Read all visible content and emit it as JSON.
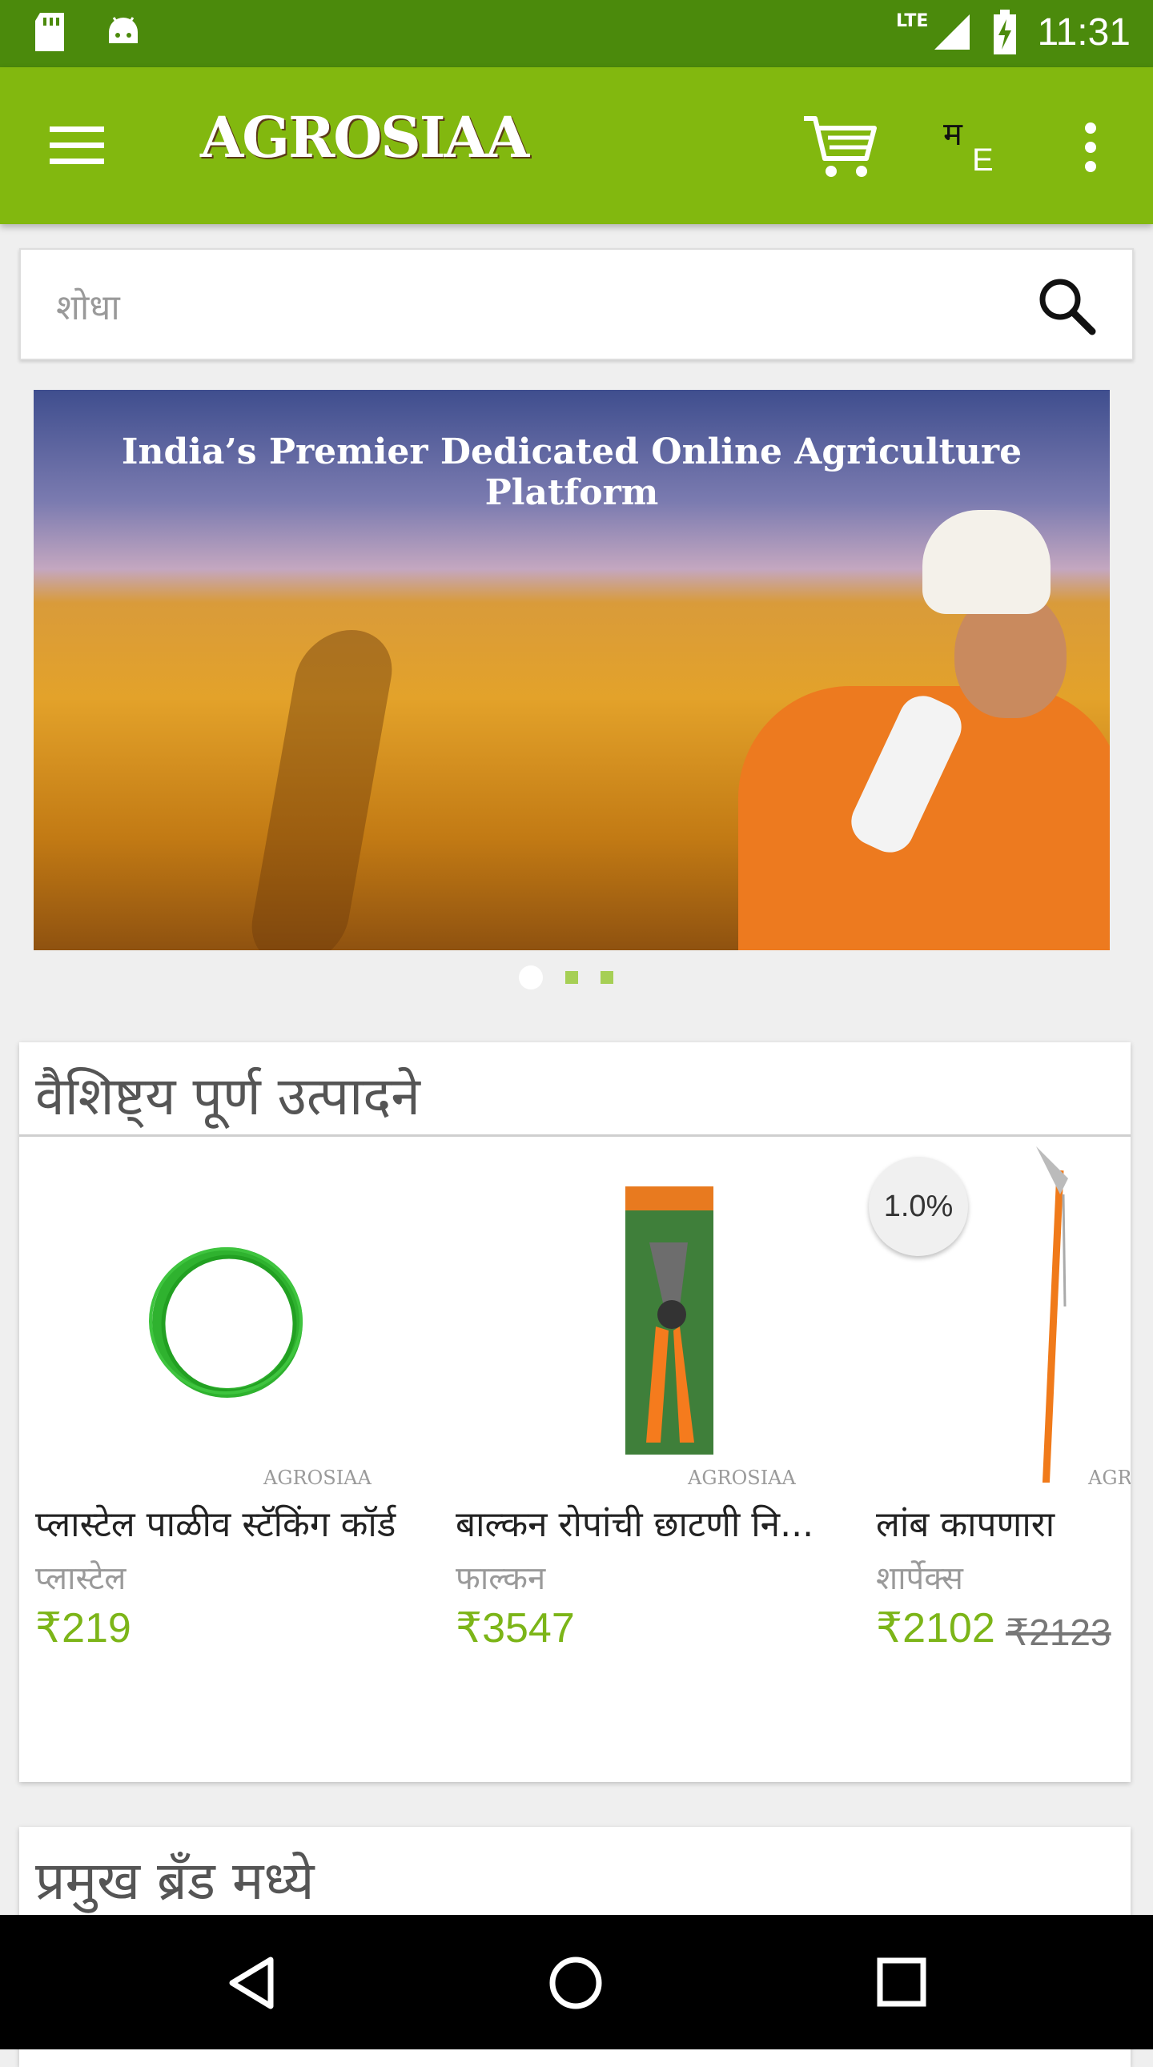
{
  "status_bar": {
    "time": "11:31",
    "network": "LTE"
  },
  "app_bar": {
    "logo_text": "AGROSIAA",
    "lang_primary": "म",
    "lang_secondary": "E"
  },
  "search": {
    "placeholder": "शोधा"
  },
  "banner": {
    "title": "India’s Premier Dedicated Online Agriculture Platform",
    "slide_count": 3,
    "active_slide": 1
  },
  "featured": {
    "title": "वैशिष्ट्य पूर्ण उत्पादने",
    "watermark": "AGROSIAA",
    "products": [
      {
        "name": "प्लास्टेल पाळीव स्टॅकिंग कॉर्ड",
        "brand": "प्लास्टेल",
        "price": "₹219"
      },
      {
        "name": "बाल्कन रोपांची छाटणी नि...",
        "brand": "फाल्कन",
        "price": "₹3547"
      },
      {
        "name": "लांब कापणारा",
        "brand": "शार्पेक्स",
        "price": "₹2102",
        "old_price": "₹2123",
        "discount": "1.0%"
      }
    ]
  },
  "brands": {
    "title": "प्रमुख ब्रँड मध्ये"
  },
  "colors": {
    "status_bar": "#4b8a0c",
    "app_bar": "#82b80f",
    "price": "#7cb518"
  }
}
